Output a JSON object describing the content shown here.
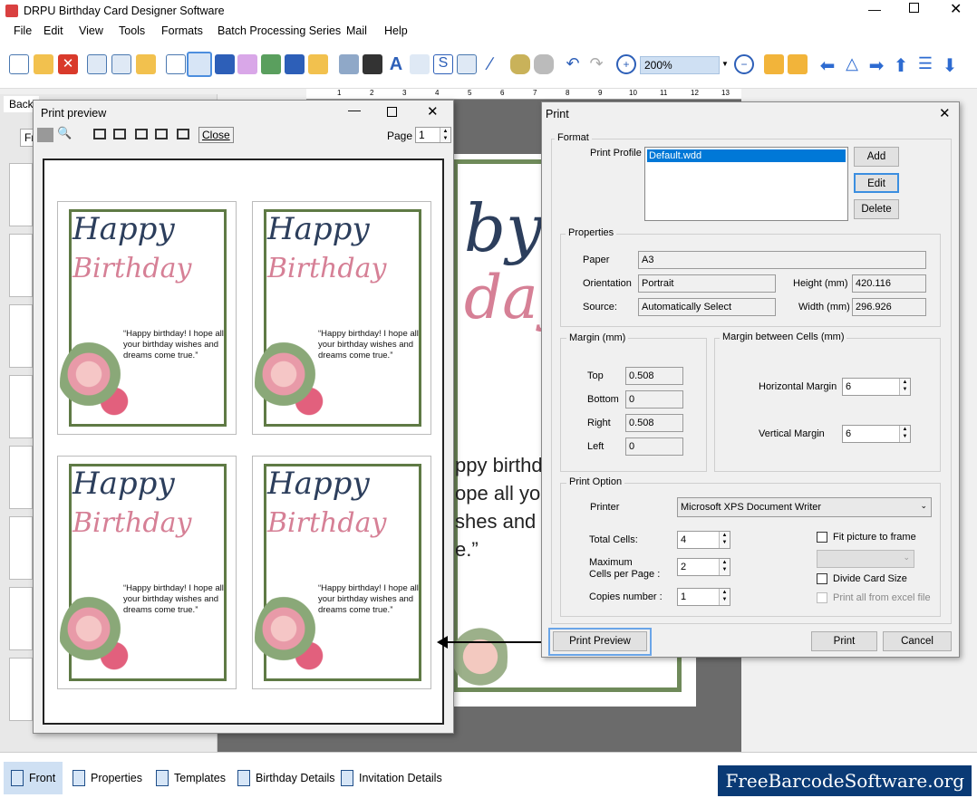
{
  "app": {
    "title": "DRPU Birthday Card Designer Software"
  },
  "menu": [
    "File",
    "Edit",
    "View",
    "Tools",
    "Formats",
    "Batch Processing Series",
    "Mail",
    "Help"
  ],
  "toolbar": {
    "zoom": "200%"
  },
  "ruler_ticks": [
    "1",
    "2",
    "3",
    "4",
    "5",
    "6",
    "7",
    "8",
    "9",
    "10",
    "11",
    "12",
    "13"
  ],
  "left_panel": {
    "tab": "Back",
    "tab2": "Fr"
  },
  "card_main": {
    "line1": "by",
    "line2": "day",
    "msg": [
      "ppy birthd",
      "ope all yo",
      "shes and d",
      "e.”"
    ]
  },
  "print_preview": {
    "title": "Print preview",
    "close": "Close",
    "page_label": "Page",
    "page_value": "1",
    "cards": [
      {
        "happy": "Happy",
        "birthday": "Birthday",
        "message": "“Happy birthday! I hope all your birthday wishes and dreams come true.”"
      },
      {
        "happy": "Happy",
        "birthday": "Birthday",
        "message": "“Happy birthday! I hope all your birthday wishes and dreams come true.”"
      },
      {
        "happy": "Happy",
        "birthday": "Birthday",
        "message": "“Happy birthday! I hope all your birthday wishes and dreams come true.”"
      },
      {
        "happy": "Happy",
        "birthday": "Birthday",
        "message": "“Happy birthday! I hope all your birthday wishes and dreams come true.”"
      }
    ]
  },
  "print_dialog": {
    "title": "Print",
    "format": "Format",
    "print_profile": "Print Profile",
    "profile_selected": "Default.wdd",
    "add": "Add",
    "edit": "Edit",
    "delete": "Delete",
    "properties": "Properties",
    "paper_label": "Paper",
    "paper": "A3",
    "orientation_label": "Orientation",
    "orientation": "Portrait",
    "source_label": "Source:",
    "source": "Automatically Select",
    "height_label": "Height (mm)",
    "height": "420.116",
    "width_label": "Width (mm)",
    "width": "296.926",
    "margin": "Margin (mm)",
    "top_label": "Top",
    "top": "0.508",
    "bottom_label": "Bottom",
    "bottom": "0",
    "right_label": "Right",
    "right": "0.508",
    "left_label": "Left",
    "left": "0",
    "cells_margin": "Margin between Cells (mm)",
    "hmargin_label": "Horizontal Margin",
    "hmargin": "6",
    "vmargin_label": "Vertical Margin",
    "vmargin": "6",
    "print_option": "Print Option",
    "printer_label": "Printer",
    "printer": "Microsoft XPS Document Writer",
    "total_cells_label": "Total Cells:",
    "total_cells": "4",
    "max_cells_label1": "Maximum",
    "max_cells_label2": "Cells per Page :",
    "max_cells": "2",
    "copies_label": "Copies number :",
    "copies": "1",
    "fit_picture": "Fit picture to frame",
    "divide_card": "Divide Card Size",
    "print_all": "Print all from excel file",
    "print_preview_btn": "Print Preview",
    "print_btn": "Print",
    "cancel_btn": "Cancel"
  },
  "bottom_tabs": [
    "Front",
    "Properties",
    "Templates",
    "Birthday Details",
    "Invitation Details"
  ],
  "brand": "FreeBarcodeSoftware.org"
}
